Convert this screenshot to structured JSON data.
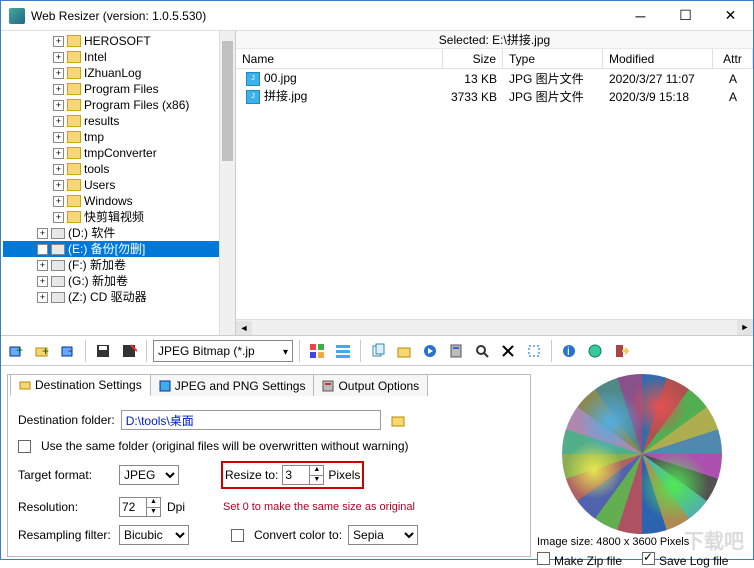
{
  "titlebar": {
    "title": "Web Resizer (version: 1.0.5.530)"
  },
  "tree": {
    "folders": [
      "HEROSOFT",
      "Intel",
      "IZhuanLog",
      "Program Files",
      "Program Files (x86)",
      "results",
      "tmp",
      "tmpConverter",
      "tools",
      "Users",
      "Windows",
      "快剪辑视频"
    ],
    "drives": [
      {
        "label": "(D:) 软件",
        "sel": false
      },
      {
        "label": "(E:) 备份[勿删]",
        "sel": true
      },
      {
        "label": "(F:) 新加卷",
        "sel": false
      },
      {
        "label": "(G:) 新加卷",
        "sel": false
      },
      {
        "label": "(Z:) CD 驱动器",
        "sel": false
      }
    ]
  },
  "rightpane": {
    "header": "Selected: E:\\拼接.jpg",
    "cols": {
      "name": "Name",
      "size": "Size",
      "type": "Type",
      "mod": "Modified",
      "attr": "Attr"
    },
    "rows": [
      {
        "name": "00.jpg",
        "size": "13 KB",
        "type": "JPG 图片文件",
        "mod": "2020/3/27 11:07",
        "attr": "A"
      },
      {
        "name": "拼接.jpg",
        "size": "3733 KB",
        "type": "JPG 图片文件",
        "mod": "2020/3/9 15:18",
        "attr": "A"
      }
    ]
  },
  "toolbar": {
    "format_combo": "JPEG Bitmap (*.jp"
  },
  "tabs": {
    "t1": "Destination Settings",
    "t2": "JPEG and PNG Settings",
    "t3": "Output Options"
  },
  "form": {
    "dest_label": "Destination folder:",
    "dest_value": "D:\\tools\\桌面",
    "samefolder": "Use the same folder (original files will be overwritten without warning)",
    "target_label": "Target format:",
    "target_value": "JPEG",
    "resize_label": "Resize to:",
    "resize_value": "3",
    "resize_unit": "Pixels",
    "resize_note": "Set 0 to make the same size as original",
    "res_label": "Resolution:",
    "res_value": "72",
    "res_unit": "Dpi",
    "resample_label": "Resampling filter:",
    "resample_value": "Bicubic",
    "convert_label": "Convert color to:",
    "convert_value": "Sepia"
  },
  "preview": {
    "size_label": "Image size: 4800 x 3600 Pixels",
    "zip": "Make Zip file",
    "log": "Save Log file"
  },
  "watermark": "下载吧"
}
